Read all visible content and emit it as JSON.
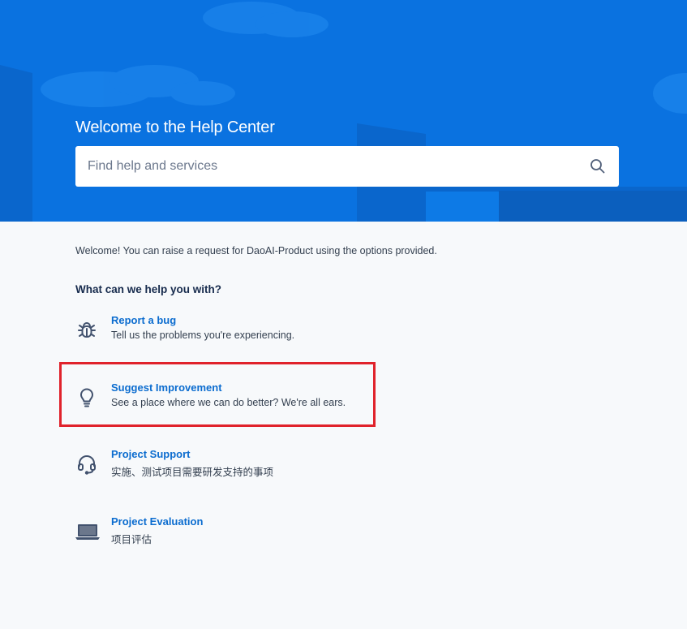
{
  "hero": {
    "title": "Welcome to the Help Center",
    "search_placeholder": "Find help and services",
    "search_icon": "search-icon",
    "background_color": "#0a72e0"
  },
  "main": {
    "welcome_text": "Welcome! You can raise a request for DaoAI-Product using the options provided.",
    "question": "What can we help you with?",
    "options": [
      {
        "title": "Report a bug",
        "description": "Tell us the problems you're experiencing.",
        "icon": "bug-icon"
      },
      {
        "title": "Suggest Improvement",
        "description": "See a place where we can do better? We're all ears.",
        "icon": "lightbulb-icon",
        "highlighted": true
      },
      {
        "title": "Project Support",
        "description": "实施、测试项目需要研发支持的事项",
        "icon": "headset-icon"
      },
      {
        "title": "Project Evaluation",
        "description": "项目评估",
        "icon": "laptop-icon"
      }
    ]
  },
  "colors": {
    "link": "#0b6ccf",
    "highlight_border": "#e0222b",
    "page_background": "#f7f9fb"
  }
}
